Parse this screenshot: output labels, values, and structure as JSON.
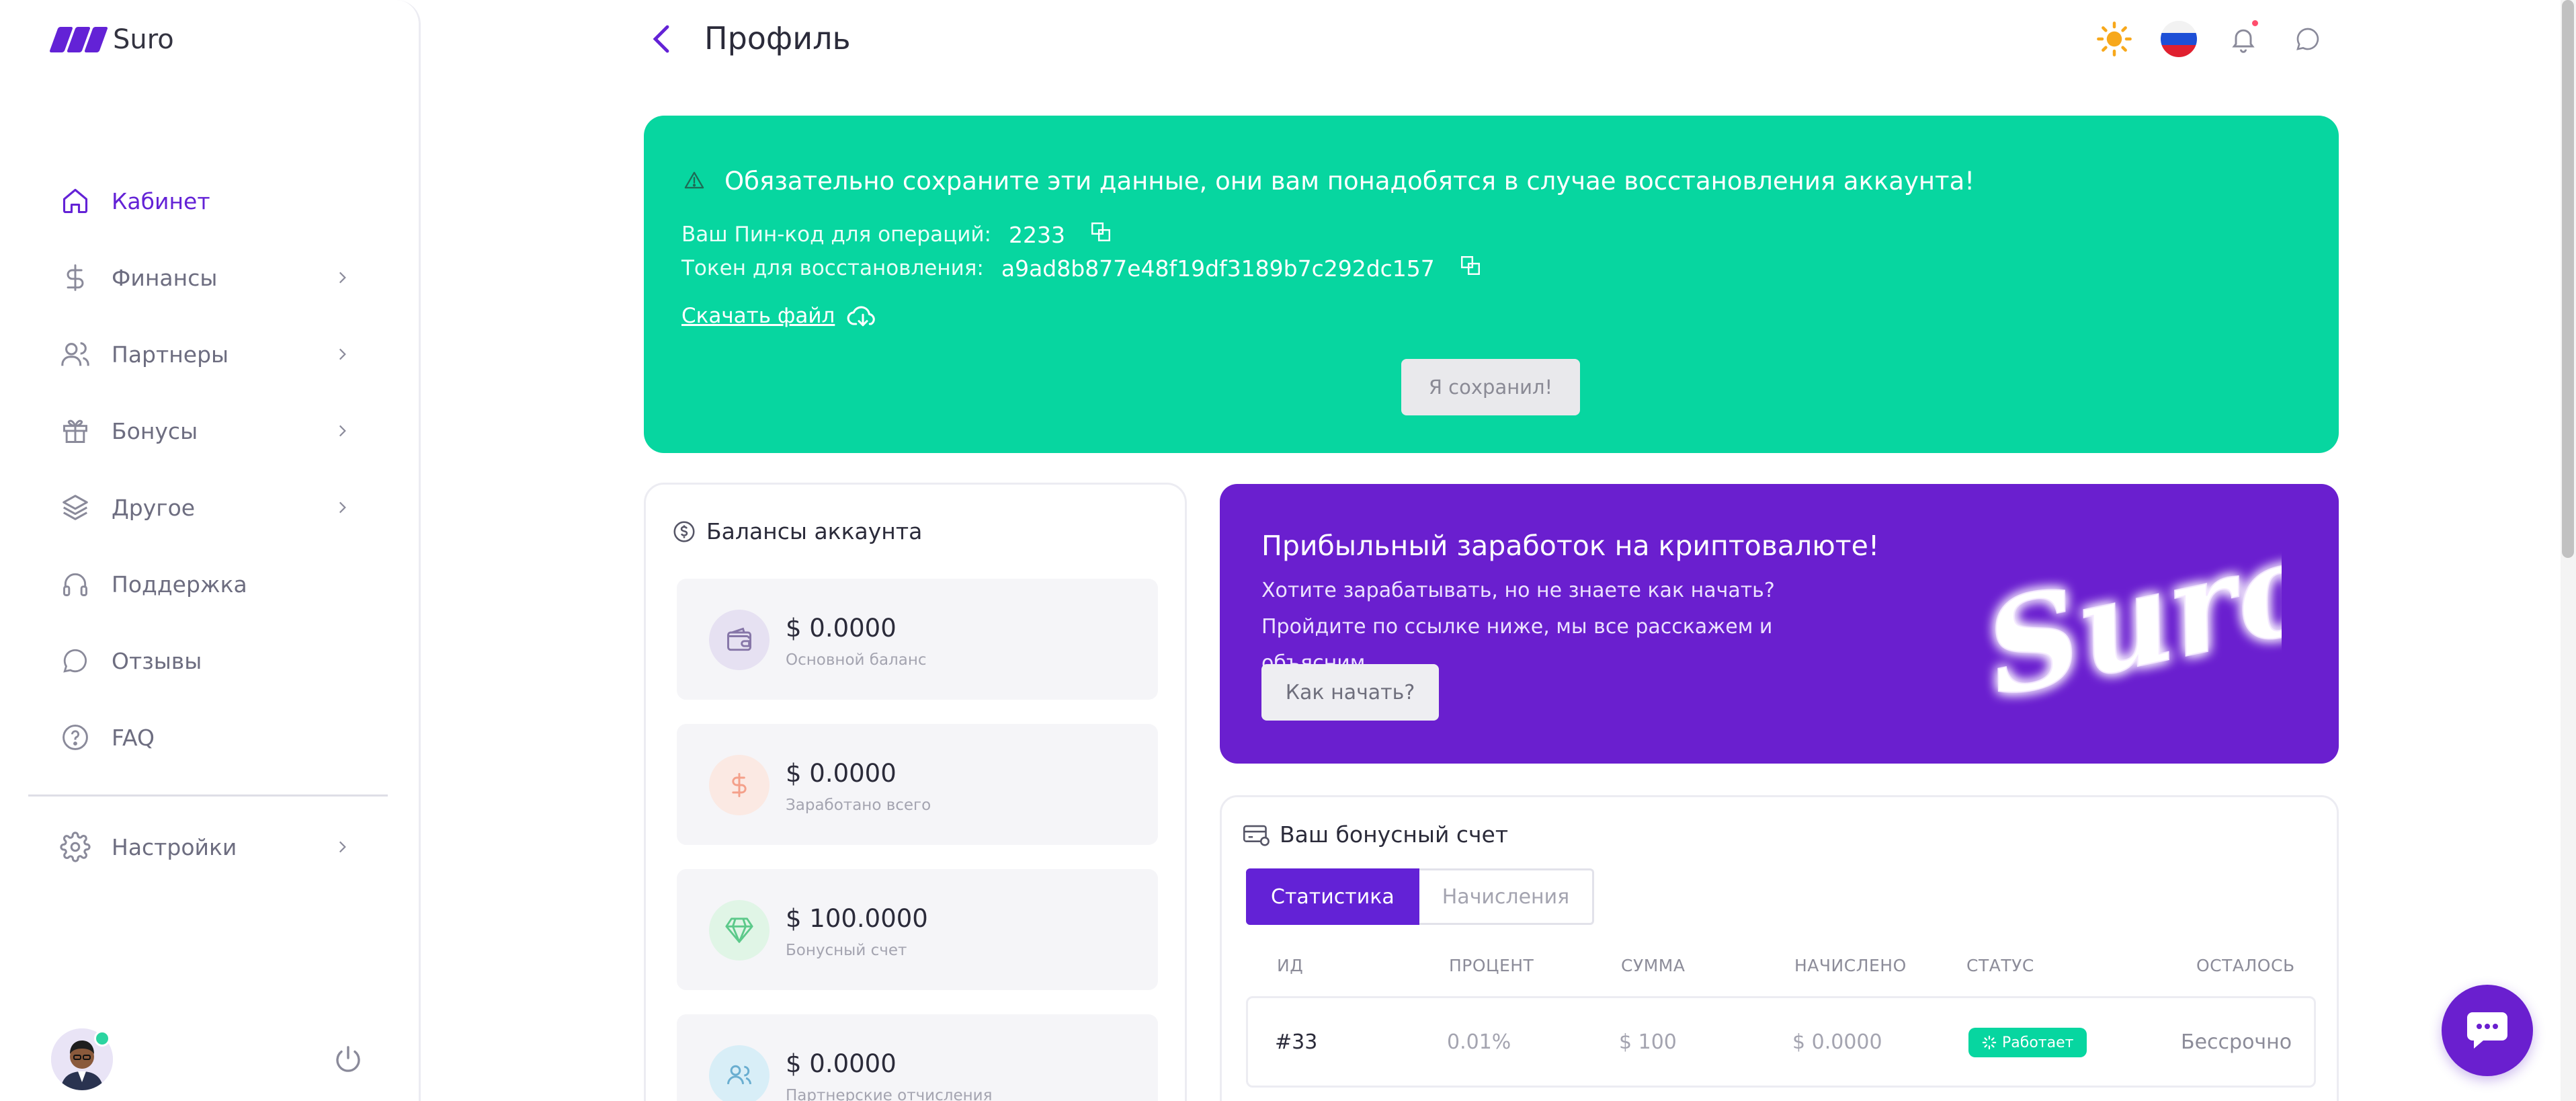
{
  "app": {
    "name": "Suro"
  },
  "sidebar": {
    "items": [
      {
        "label": "Кабинет",
        "icon": "home-icon",
        "active": true,
        "chevron": false
      },
      {
        "label": "Финансы",
        "icon": "dollar-icon",
        "active": false,
        "chevron": true
      },
      {
        "label": "Партнеры",
        "icon": "users-icon",
        "active": false,
        "chevron": true
      },
      {
        "label": "Бонусы",
        "icon": "gift-icon",
        "active": false,
        "chevron": true
      },
      {
        "label": "Другое",
        "icon": "layers-icon",
        "active": false,
        "chevron": true
      },
      {
        "label": "Поддержка",
        "icon": "headphones-icon",
        "active": false,
        "chevron": false
      },
      {
        "label": "Отзывы",
        "icon": "message-icon",
        "active": false,
        "chevron": false
      },
      {
        "label": "FAQ",
        "icon": "help-icon",
        "active": false,
        "chevron": false
      }
    ],
    "settings": {
      "label": "Настройки",
      "icon": "gear-icon"
    }
  },
  "header": {
    "title": "Профиль"
  },
  "alert": {
    "message": "Обязательно сохраните эти данные, они вам понадобятся в случае восстановления аккаунта!",
    "pin_label": "Ваш Пин-код для операций:",
    "pin_value": "2233",
    "token_label": "Токен для восстановления:",
    "token_value": "a9ad8b877e48f19df3189b7c292dc157",
    "download_label": "Скачать файл",
    "saved_button": "Я сохранил!"
  },
  "balances": {
    "title": "Балансы аккаунта",
    "items": [
      {
        "amount": "$ 0.0000",
        "label": "Основной баланс",
        "icon": "wallet-icon"
      },
      {
        "amount": "$ 0.0000",
        "label": "Заработано всего",
        "icon": "coin-icon"
      },
      {
        "amount": "$ 100.0000",
        "label": "Бонусный счет",
        "icon": "diamond-icon"
      },
      {
        "amount": "$ 0.0000",
        "label": "Партнерские отчисления",
        "icon": "partners-icon"
      }
    ]
  },
  "promo": {
    "title": "Прибыльный заработок на криптовалюте!",
    "text": "Хотите зарабатывать, но не знаете как начать? Пройдите по ссылке ниже, мы все расскажем и объясним.",
    "button": "Как начать?",
    "neon_logo": "Suro"
  },
  "bonus": {
    "title": "Ваш бонусный счет",
    "tabs": [
      "Статистика",
      "Начисления"
    ],
    "columns": [
      "ИД",
      "ПРОЦЕНТ",
      "СУММА",
      "НАЧИСЛЕНО",
      "СТАТУС",
      "ОСТАЛОСЬ"
    ],
    "rows": [
      {
        "id": "#33",
        "percent": "0.01%",
        "sum": "$ 100",
        "accrued": "$ 0.0000",
        "status": "Работает",
        "left": "Бессрочно"
      }
    ]
  },
  "colors": {
    "accent": "#6322d6",
    "alert_green": "#07d6a0",
    "promo_purple": "#6a1fcf"
  }
}
